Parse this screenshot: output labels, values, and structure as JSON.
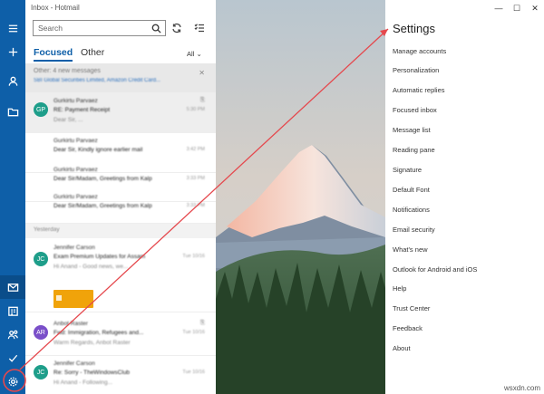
{
  "window": {
    "title": "Inbox - Hotmail"
  },
  "search": {
    "placeholder": "Search"
  },
  "tabs": [
    {
      "label": "Focused"
    },
    {
      "label": "Other"
    }
  ],
  "filter": {
    "label": "All"
  },
  "notice": {
    "title": "Other: 4 new messages",
    "detail": "SBI Global Securities Limited, Amazon Credit Card..."
  },
  "messages": [
    {
      "initials": "GP",
      "from": "Gurkirtu Parvaez",
      "subject": "RE: Payment Receipt",
      "preview": "Dear Sir, ...",
      "time": "5:30 PM",
      "color": "#1e9e8a"
    },
    {
      "initials": "",
      "from": "Gurkirtu Parvaez",
      "subject": "Dear Sir, Kindly ignore earlier mail",
      "preview": "",
      "time": "3:42 PM",
      "color": ""
    },
    {
      "initials": "",
      "from": "Gurkirtu Parvaez",
      "subject": "Dear Sir/Madam, Greetings from Kalp",
      "preview": "",
      "time": "3:33 PM",
      "color": ""
    },
    {
      "initials": "",
      "from": "Gurkirtu Parvaez",
      "subject": "Dear Sir/Madam, Greetings from Kalp",
      "preview": "",
      "time": "3:33 PM",
      "color": ""
    },
    {
      "initials": "JC",
      "from": "Jennifer Carson",
      "subject": "Exam Premium Updates for Assam",
      "preview": "Hi Anand - Good news, we...",
      "time": "Tue 10/16",
      "color": "#1e9e8a"
    },
    {
      "initials": "AR",
      "from": "Anbot Raster",
      "subject": "Fwd: Immigration, Refugees and...",
      "preview": "Warm Regards, Anbot Raster",
      "time": "Tue 10/16",
      "color": "#7a4fc9"
    },
    {
      "initials": "JC",
      "from": "Jennifer Carson",
      "subject": "Re: Sorry - TheWindowsClub",
      "preview": "Hi Anand - Following...",
      "time": "Tue 10/16",
      "color": "#1e9e8a"
    }
  ],
  "day_separator": "Yesterday",
  "settings": {
    "title": "Settings",
    "items": [
      "Manage accounts",
      "Personalization",
      "Automatic replies",
      "Focused inbox",
      "Message list",
      "Reading pane",
      "Signature",
      "Default Font",
      "Notifications",
      "Email security",
      "What's new",
      "Outlook for Android and iOS",
      "Help",
      "Trust Center",
      "Feedback",
      "About"
    ]
  },
  "caption_buttons": {
    "minimize": "—",
    "maximize": "☐",
    "close": "✕"
  },
  "watermark": "wsxdn.com",
  "colors": {
    "accent": "#0e5fa8",
    "annotation": "#e5484d"
  }
}
